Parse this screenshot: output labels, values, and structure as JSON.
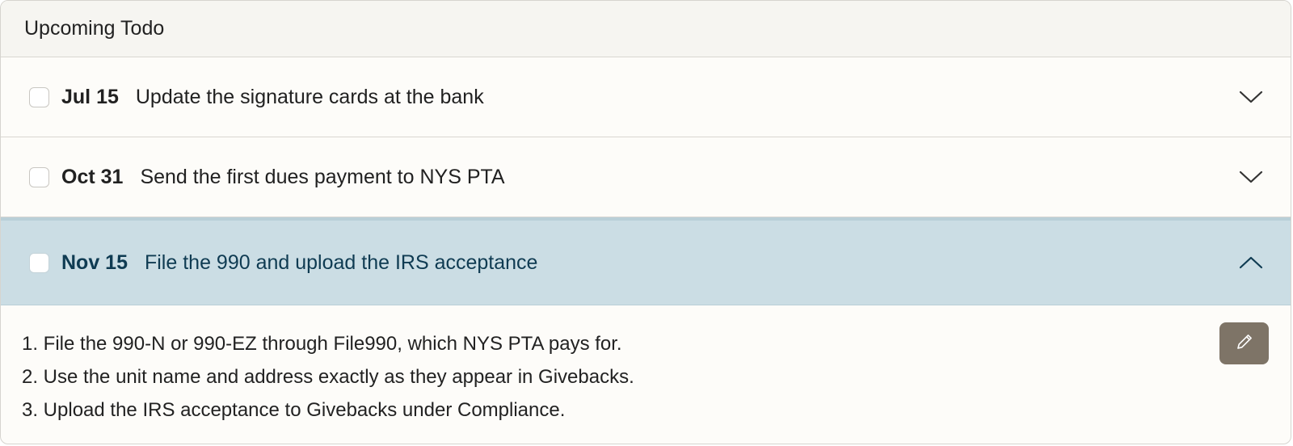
{
  "card": {
    "title": "Upcoming Todo"
  },
  "todos": [
    {
      "date": "Jul 15",
      "title": "Update the signature cards at the bank",
      "expanded": false,
      "checked": false
    },
    {
      "date": "Oct 31",
      "title": "Send the first dues payment to NYS PTA",
      "expanded": false,
      "checked": false
    },
    {
      "date": "Nov 15",
      "title": "File the 990 and upload the IRS acceptance",
      "expanded": true,
      "checked": false,
      "details": [
        "1. File the 990-N or 990-EZ through File990, which NYS PTA pays for.",
        "2. Use the unit name and address exactly as they appear in Givebacks.",
        "3. Upload the IRS acceptance to Givebacks under Compliance."
      ]
    }
  ],
  "icons": {
    "collapsed_chevron": "chevron-down-icon",
    "expanded_chevron": "chevron-up-icon",
    "edit": "pencil-icon"
  },
  "colors": {
    "expanded_background": "#cbdde4",
    "expanded_text": "#0f3b52",
    "edit_button": "#7e7467"
  }
}
